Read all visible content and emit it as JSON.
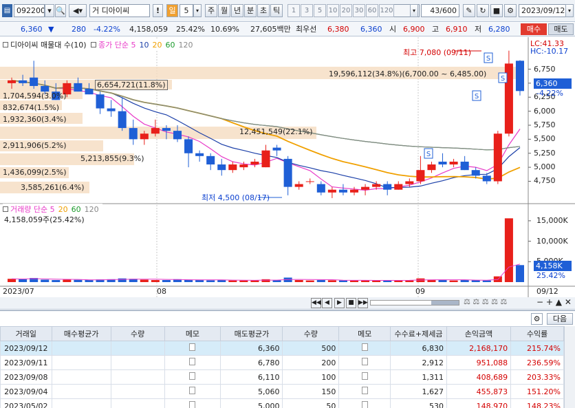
{
  "toolbar": {
    "code": "092200",
    "name": "디아이씨",
    "exclaim": "!",
    "period_day": "일",
    "period_value": "5",
    "period_tabs": [
      "주",
      "월",
      "년",
      "분",
      "초",
      "틱"
    ],
    "numbers": [
      "1",
      "3",
      "5",
      "10",
      "20",
      "30",
      "60",
      "120"
    ],
    "count": "43",
    "count_total": "/600",
    "date": "2023/09/12"
  },
  "quote": {
    "price": "6,360",
    "arrow": "▼",
    "change": "280",
    "change_pct": "-4.22%",
    "volume": "4,158,059",
    "turnover": "25.42%",
    "ratio": "10.69%",
    "amount": "27,605백만",
    "best_label": "최우선",
    "ask": "6,380",
    "bid": "6,360",
    "open_label": "시",
    "open": "6,900",
    "high_label": "고",
    "high": "6,910",
    "low_label": "저",
    "low": "6,280",
    "buy_label": "매수",
    "sell_label": "매도"
  },
  "chart": {
    "price_panel_title": "디아이씨 매물대 수(10)",
    "ma_label": "종가 단순",
    "ma_periods": [
      "5",
      "10",
      "20",
      "60",
      "120"
    ],
    "lc": "LC:41.33",
    "hc": "HC:-10.17",
    "high_annot": "최고 7,080 (09/11)",
    "low_annot": "최저 4,500 (08/17)",
    "last_price": "6,360",
    "last_pct": "-4.22%",
    "price_ticks": [
      "6,750",
      "6,500",
      "6,250",
      "6,000",
      "5,750",
      "5,500",
      "5,250",
      "5,000",
      "4,750"
    ],
    "volume_profile": [
      "19,596,112(34.8%)(6,700.00 ~ 6,485.00)",
      "6,654,721(11.8%)",
      "1,704,594(3.0%)",
      "832,674(1.5%)",
      "1,932,360(3.4%)",
      "12,451,549(22.1%)",
      "2,911,906(5.2%)",
      "5,213,855(9.3%)",
      "1,436,099(2.5%)",
      "3,585,261(6.4%)"
    ],
    "volume_panel_title": "거래량 단순",
    "vol_ma_periods": [
      "5",
      "20",
      "60",
      "120"
    ],
    "volume_info": "4,158,059주(25.42%)",
    "vol_ticks": [
      "15,000K",
      "10,000K",
      "5,000K"
    ],
    "last_vol": "4,158K",
    "last_vol_pct": "25.42%",
    "x_labels": [
      "2023/07",
      "08",
      "09",
      "09/12"
    ],
    "colors": {
      "up": "#e8201a",
      "down": "#1f5fd6",
      "ma5": "#e83ac8",
      "ma10": "#1b3fa8",
      "ma20": "#f0a000",
      "ma60": "#1a9a2a",
      "ma120": "#888888",
      "profile": "#f5dcc0"
    }
  },
  "chart_data": {
    "type": "candlestick",
    "dates": [
      "07/03",
      "07/04",
      "07/05",
      "07/06",
      "07/07",
      "07/10",
      "07/11",
      "07/12",
      "07/13",
      "07/14",
      "07/17",
      "07/18",
      "07/19",
      "07/20",
      "07/21",
      "07/24",
      "07/25",
      "07/26",
      "07/27",
      "07/28",
      "07/31",
      "08/01",
      "08/02",
      "08/03",
      "08/04",
      "08/07",
      "08/08",
      "08/09",
      "08/10",
      "08/11",
      "08/14",
      "08/16",
      "08/17",
      "08/18",
      "08/21",
      "08/22",
      "08/23",
      "08/24",
      "08/25",
      "08/28",
      "08/29",
      "08/30",
      "08/31",
      "09/01",
      "09/04",
      "09/05",
      "09/06",
      "09/07",
      "09/08",
      "09/11",
      "09/12"
    ],
    "ohlc": [
      [
        6500,
        6600,
        6400,
        6550
      ],
      [
        6550,
        6650,
        6450,
        6500
      ],
      [
        6600,
        6900,
        6400,
        6450
      ],
      [
        6450,
        6550,
        6300,
        6350
      ],
      [
        6350,
        6500,
        6200,
        6200
      ],
      [
        6300,
        6550,
        6250,
        6500
      ],
      [
        6500,
        6600,
        6350,
        6350
      ],
      [
        6400,
        6500,
        6300,
        6300
      ],
      [
        6300,
        6350,
        5950,
        6050
      ],
      [
        6050,
        6200,
        5900,
        6000
      ],
      [
        6000,
        6250,
        5650,
        5700
      ],
      [
        5700,
        5850,
        5400,
        5500
      ],
      [
        5500,
        5650,
        5400,
        5600
      ],
      [
        5600,
        5850,
        5550,
        5700
      ],
      [
        5700,
        5750,
        5500,
        5650
      ],
      [
        5650,
        5750,
        5450,
        5500
      ],
      [
        5500,
        5550,
        5000,
        5250
      ],
      [
        5250,
        5300,
        5100,
        5200
      ],
      [
        5200,
        5250,
        4950,
        5050
      ],
      [
        5050,
        5150,
        4850,
        4950
      ],
      [
        4950,
        5100,
        4900,
        5050
      ],
      [
        5000,
        5100,
        4950,
        5050
      ],
      [
        5050,
        5150,
        5000,
        5100
      ],
      [
        5000,
        5400,
        5000,
        5300
      ],
      [
        5350,
        5400,
        5200,
        5300
      ],
      [
        5150,
        5200,
        4500,
        4650
      ],
      [
        4650,
        4750,
        4600,
        4700
      ],
      [
        4750,
        4800,
        4700,
        4750
      ],
      [
        4700,
        4750,
        4500,
        4550
      ],
      [
        4550,
        4650,
        4450,
        4600
      ],
      [
        4600,
        4700,
        4500,
        4550
      ],
      [
        4550,
        4650,
        4500,
        4600
      ],
      [
        4600,
        4700,
        4500,
        4650
      ],
      [
        4650,
        4750,
        4600,
        4700
      ],
      [
        4700,
        4750,
        4500,
        4600
      ],
      [
        4600,
        4750,
        4600,
        4700
      ],
      [
        4700,
        4800,
        4650,
        4750
      ],
      [
        4750,
        5200,
        4700,
        4950
      ],
      [
        4950,
        5100,
        4900,
        5050
      ],
      [
        5100,
        5250,
        5000,
        5050
      ],
      [
        5050,
        5150,
        5000,
        5100
      ],
      [
        5100,
        5200,
        4950,
        4950
      ],
      [
        4950,
        5000,
        4800,
        4850
      ],
      [
        4850,
        4900,
        4700,
        4750
      ],
      [
        4750,
        5650,
        4700,
        5600
      ],
      [
        5600,
        7080,
        5550,
        6850
      ],
      [
        6900,
        6910,
        6280,
        6360
      ]
    ],
    "volume_k": [
      800,
      700,
      1000,
      600,
      500,
      600,
      550,
      500,
      650,
      700,
      900,
      800,
      600,
      500,
      500,
      700,
      600,
      500,
      450,
      500,
      400,
      400,
      450,
      700,
      500,
      1100,
      500,
      400,
      500,
      450,
      400,
      400,
      450,
      400,
      450,
      400,
      450,
      900,
      600,
      500,
      400,
      500,
      450,
      400,
      1400,
      15600,
      4158
    ],
    "ylim": [
      4400,
      7100
    ],
    "vol_ylim": [
      0,
      17000
    ]
  },
  "grid": {
    "next_label": "다음",
    "headers": [
      "거래일",
      "매수평균가",
      "수량",
      "메모",
      "매도평균가",
      "수량",
      "메모",
      "수수료+제세금",
      "손익금액",
      "수익률"
    ],
    "rows": [
      [
        "2023/09/12",
        "",
        "",
        "",
        "6,360",
        "500",
        "",
        "6,830",
        "2,168,170",
        "215.74%"
      ],
      [
        "2023/09/11",
        "",
        "",
        "",
        "6,780",
        "200",
        "",
        "2,912",
        "951,088",
        "236.59%"
      ],
      [
        "2023/09/08",
        "",
        "",
        "",
        "6,110",
        "100",
        "",
        "1,311",
        "408,689",
        "203.33%"
      ],
      [
        "2023/09/04",
        "",
        "",
        "",
        "5,060",
        "150",
        "",
        "1,627",
        "455,873",
        "151.20%"
      ],
      [
        "2023/05/02",
        "",
        "",
        "",
        "5,000",
        "50",
        "",
        "530",
        "148,970",
        "148.23%"
      ]
    ]
  }
}
